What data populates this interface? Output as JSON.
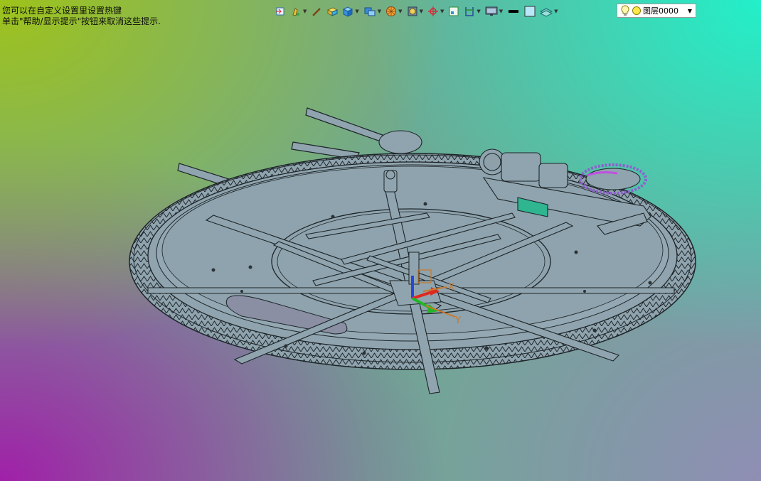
{
  "hints": {
    "line1": "您可以在自定义设置里设置热键",
    "line2": "单击\"帮助/显示提示\"按钮来取消这些提示."
  },
  "toolbar": {
    "icons": [
      "view-import-icon",
      "paint-icon",
      "pen-icon",
      "box-yellow-icon",
      "cube-icon",
      "cube-rotate-icon",
      "sphere-icon",
      "frame-icon",
      "axis-icon",
      "window-icon",
      "section-icon",
      "monitor-icon",
      "line-color-icon",
      "fill-color-icon",
      "layer-stack-icon"
    ]
  },
  "layer_selector": {
    "label": "图层0000"
  },
  "axis": {
    "x_label": "X",
    "y_label": "Y"
  },
  "colors": {
    "model_fill": "#8fa4ae",
    "model_edge": "#1d2428",
    "axis_x": "#e0281e",
    "axis_y": "#22b528",
    "axis_z": "#2845e0",
    "hint_text": "#0b0b0b"
  }
}
